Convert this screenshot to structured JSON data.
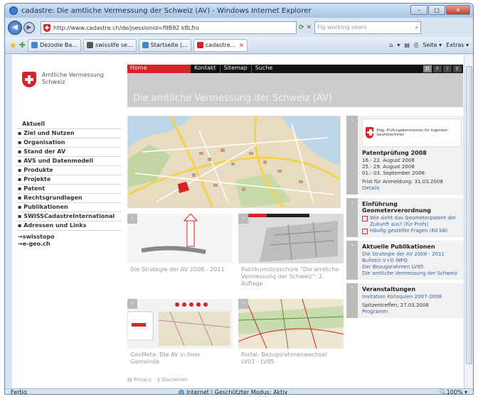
{
  "browser": {
    "title": "cadastre: Die amtliche Vermessung der Schweiz (AV) - Windows Internet Explorer",
    "url": "http://www.cadastre.ch/de/jsessionid=f9B92 k8Lfro",
    "search_placeholder": "Fig working sears",
    "window_buttons": {
      "minimize": "–",
      "maximize": "□",
      "close": "✕"
    },
    "tabs": [
      {
        "label": "Dezodie Ba..."
      },
      {
        "label": "swisslife se..."
      },
      {
        "label": "Startseite (..."
      },
      {
        "label": "cadastre..."
      }
    ],
    "tab_close": "×",
    "commands": {
      "home": "▾",
      "page": "Seite ▾",
      "tools": "Extras ▾"
    },
    "status": {
      "left": "Fertig",
      "middle": "Internet | Geschützter Modus: Aktiv",
      "zoom": "100%"
    }
  },
  "site": {
    "logo_line1": "Amtliche Vermessung",
    "logo_line2": "Schweiz",
    "topnav": [
      "Home",
      "Kontakt",
      "Sitemap",
      "Suche"
    ],
    "languages": [
      "D",
      "F",
      "I",
      "E"
    ],
    "banner_title": "Die amtliche Vermessung der Schweiz (AV)",
    "sidenav": [
      "Aktuell",
      "Ziel und Nutzen",
      "Organisation",
      "Stand der AV",
      "AVS und Datenmodell",
      "Produkte",
      "Projekte",
      "Patent",
      "Rechtsgrundlagen",
      "Publikationen",
      "SWISSCadastreInternational",
      "Adressen und Links"
    ],
    "external_links": [
      "swisstopo",
      "e-geo.ch"
    ],
    "tiles": [
      {
        "caption": "Die Strategie der AV 2008 - 2011"
      },
      {
        "caption": "Publikumsbroschüre \"Die amtliche Vermessung der Schweiz\": 2. Auflage"
      },
      {
        "caption": "GeoMeta: Die AV in Ihrer Gemeinde"
      },
      {
        "caption": "Portal: Bezugsrahmenwechsel LV03 - LV95"
      }
    ],
    "footer": [
      "Privacy",
      "Disclaimer"
    ],
    "right": {
      "pruef_title": "Eidg. Prüfungskommission für Ingenieur-Geometerinnen",
      "patent_title": "Patentprüfung 2008",
      "patent_dates": [
        "16.- 22. August 2008",
        "25.- 29. August 2008",
        "01.- 03. September 2008"
      ],
      "patent_deadline": "Frist für Anmeldung: 31.03.2008",
      "patent_details": "Details",
      "geo_title": "Einführung Geometerverordnung",
      "geo_links": [
        "Wie sieht das Geometerpatent der Zukunft aus? (für Profs)",
        "Häufig gestellte Fragen (60 kB)"
      ],
      "pub_title": "Aktuelle Publikationen",
      "pub_links": [
        "Die Strategie der AV 2008 - 2011",
        "Bulletin V+D INFO",
        "Der Bezugsrahmen LV95",
        "Die amtliche Vermessung der Schweiz"
      ],
      "events_title": "Veranstaltungen",
      "events_links": [
        "Invitation Kolloquien 2007-2008"
      ],
      "events_text": "Spitzentreffen, 27.03.2008",
      "events_program": "Programm"
    }
  },
  "colors": {
    "swiss_red": "#d8232a",
    "link_blue": "#3a62a8",
    "banner_gray": "#cccccc"
  }
}
